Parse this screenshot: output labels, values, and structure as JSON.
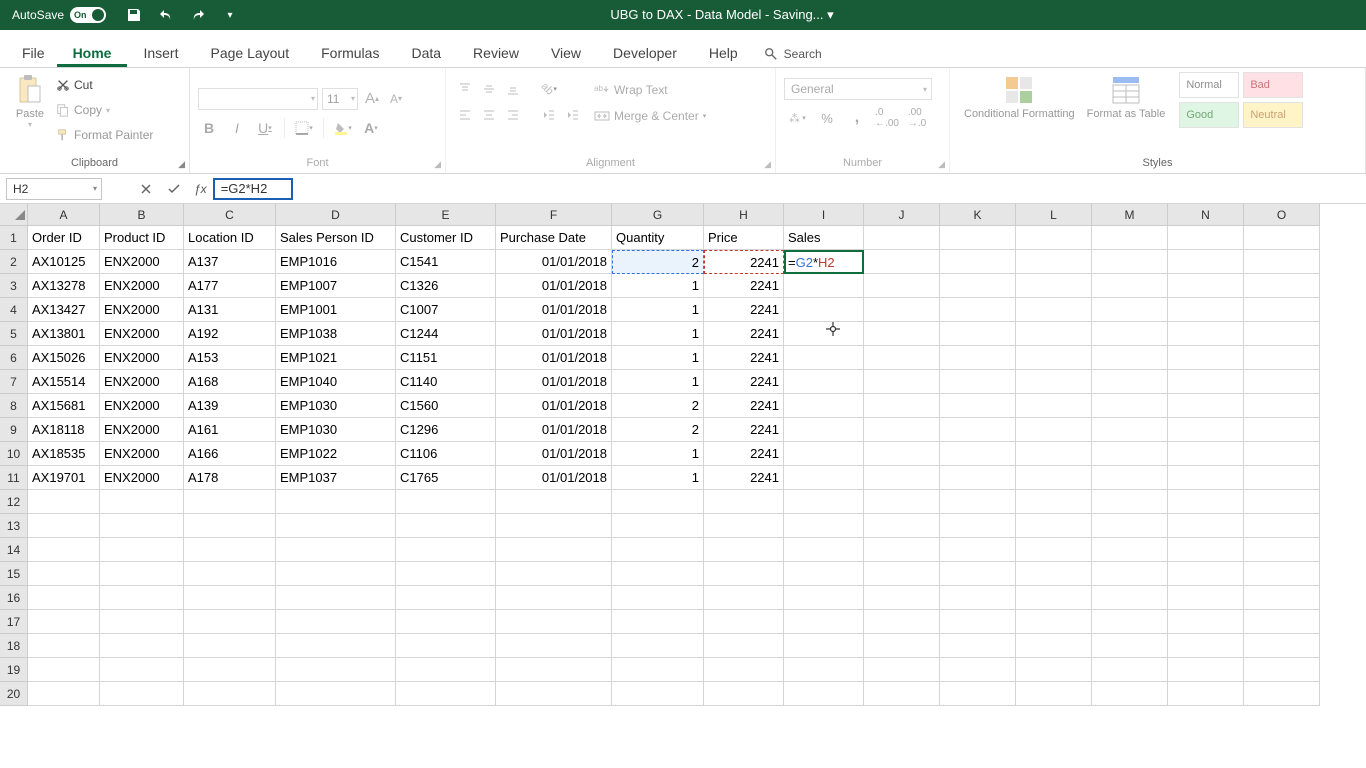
{
  "titlebar": {
    "autosave_label": "AutoSave",
    "autosave_on": "On",
    "doc_title": "UBG to DAX - Data Model - Saving... ▾"
  },
  "tabs": {
    "file": "File",
    "home": "Home",
    "insert": "Insert",
    "page_layout": "Page Layout",
    "formulas": "Formulas",
    "data": "Data",
    "review": "Review",
    "view": "View",
    "developer": "Developer",
    "help": "Help",
    "search": "Search"
  },
  "ribbon": {
    "clipboard": {
      "paste": "Paste",
      "cut": "Cut",
      "copy": "Copy",
      "format_painter": "Format Painter",
      "label": "Clipboard"
    },
    "font": {
      "size": "11",
      "label": "Font"
    },
    "alignment": {
      "wrap": "Wrap Text",
      "merge": "Merge & Center",
      "label": "Alignment"
    },
    "number": {
      "format": "General",
      "label": "Number"
    },
    "styles": {
      "cond": "Conditional Formatting",
      "table": "Format as Table",
      "normal": "Normal",
      "bad": "Bad",
      "good": "Good",
      "neutral": "Neutral",
      "label": "Styles"
    }
  },
  "formula_bar": {
    "name_box": "H2",
    "formula": "=G2*H2"
  },
  "grid": {
    "columns": [
      "A",
      "B",
      "C",
      "D",
      "E",
      "F",
      "G",
      "H",
      "I",
      "J",
      "K",
      "L",
      "M",
      "N",
      "O"
    ],
    "headers": [
      "Order ID",
      "Product ID",
      "Location ID",
      "Sales Person ID",
      "Customer ID",
      "Purchase Date",
      "Quantity",
      "Price",
      "Sales"
    ],
    "rows": [
      {
        "n": 1
      },
      {
        "n": 2,
        "A": "AX10125",
        "B": "ENX2000",
        "C": "A137",
        "D": "EMP1016",
        "E": "C1541",
        "F": "01/01/2018",
        "G": "2",
        "H": "2241",
        "I": "=G2*H2"
      },
      {
        "n": 3,
        "A": "AX13278",
        "B": "ENX2000",
        "C": "A177",
        "D": "EMP1007",
        "E": "C1326",
        "F": "01/01/2018",
        "G": "1",
        "H": "2241"
      },
      {
        "n": 4,
        "A": "AX13427",
        "B": "ENX2000",
        "C": "A131",
        "D": "EMP1001",
        "E": "C1007",
        "F": "01/01/2018",
        "G": "1",
        "H": "2241"
      },
      {
        "n": 5,
        "A": "AX13801",
        "B": "ENX2000",
        "C": "A192",
        "D": "EMP1038",
        "E": "C1244",
        "F": "01/01/2018",
        "G": "1",
        "H": "2241"
      },
      {
        "n": 6,
        "A": "AX15026",
        "B": "ENX2000",
        "C": "A153",
        "D": "EMP1021",
        "E": "C1151",
        "F": "01/01/2018",
        "G": "1",
        "H": "2241"
      },
      {
        "n": 7,
        "A": "AX15514",
        "B": "ENX2000",
        "C": "A168",
        "D": "EMP1040",
        "E": "C1140",
        "F": "01/01/2018",
        "G": "1",
        "H": "2241"
      },
      {
        "n": 8,
        "A": "AX15681",
        "B": "ENX2000",
        "C": "A139",
        "D": "EMP1030",
        "E": "C1560",
        "F": "01/01/2018",
        "G": "2",
        "H": "2241"
      },
      {
        "n": 9,
        "A": "AX18118",
        "B": "ENX2000",
        "C": "A161",
        "D": "EMP1030",
        "E": "C1296",
        "F": "01/01/2018",
        "G": "2",
        "H": "2241"
      },
      {
        "n": 10,
        "A": "AX18535",
        "B": "ENX2000",
        "C": "A166",
        "D": "EMP1022",
        "E": "C1106",
        "F": "01/01/2018",
        "G": "1",
        "H": "2241"
      },
      {
        "n": 11,
        "A": "AX19701",
        "B": "ENX2000",
        "C": "A178",
        "D": "EMP1037",
        "E": "C1765",
        "F": "01/01/2018",
        "G": "1",
        "H": "2241"
      },
      {
        "n": 12
      },
      {
        "n": 13
      },
      {
        "n": 14
      },
      {
        "n": 15
      },
      {
        "n": 16
      },
      {
        "n": 17
      },
      {
        "n": 18
      },
      {
        "n": 19
      },
      {
        "n": 20
      }
    ]
  },
  "chart_data": {
    "type": "table",
    "title": "Sales data",
    "columns": [
      "Order ID",
      "Product ID",
      "Location ID",
      "Sales Person ID",
      "Customer ID",
      "Purchase Date",
      "Quantity",
      "Price",
      "Sales"
    ],
    "rows": [
      [
        "AX10125",
        "ENX2000",
        "A137",
        "EMP1016",
        "C1541",
        "01/01/2018",
        2,
        2241,
        "=G2*H2"
      ],
      [
        "AX13278",
        "ENX2000",
        "A177",
        "EMP1007",
        "C1326",
        "01/01/2018",
        1,
        2241,
        null
      ],
      [
        "AX13427",
        "ENX2000",
        "A131",
        "EMP1001",
        "C1007",
        "01/01/2018",
        1,
        2241,
        null
      ],
      [
        "AX13801",
        "ENX2000",
        "A192",
        "EMP1038",
        "C1244",
        "01/01/2018",
        1,
        2241,
        null
      ],
      [
        "AX15026",
        "ENX2000",
        "A153",
        "EMP1021",
        "C1151",
        "01/01/2018",
        1,
        2241,
        null
      ],
      [
        "AX15514",
        "ENX2000",
        "A168",
        "EMP1040",
        "C1140",
        "01/01/2018",
        1,
        2241,
        null
      ],
      [
        "AX15681",
        "ENX2000",
        "A139",
        "EMP1030",
        "C1560",
        "01/01/2018",
        2,
        2241,
        null
      ],
      [
        "AX18118",
        "ENX2000",
        "A161",
        "EMP1030",
        "C1296",
        "01/01/2018",
        2,
        2241,
        null
      ],
      [
        "AX18535",
        "ENX2000",
        "A166",
        "EMP1022",
        "C1106",
        "01/01/2018",
        1,
        2241,
        null
      ],
      [
        "AX19701",
        "ENX2000",
        "A178",
        "EMP1037",
        "C1765",
        "01/01/2018",
        1,
        2241,
        null
      ]
    ]
  }
}
